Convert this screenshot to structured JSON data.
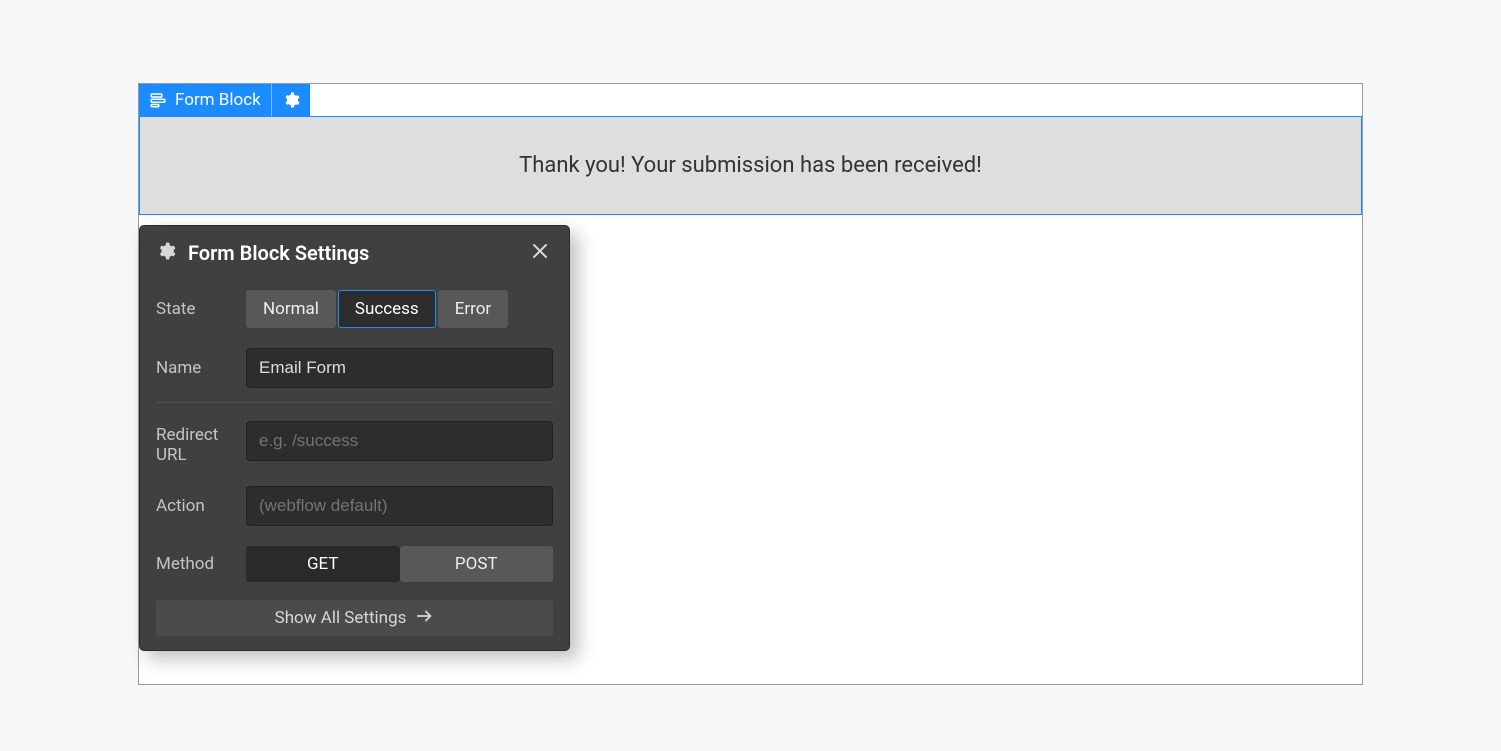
{
  "element_badge": {
    "label": "Form Block",
    "icon": "form-block-icon",
    "settings_icon": "gear-icon"
  },
  "success_message": "Thank you! Your submission has been received!",
  "settings": {
    "title": "Form Block Settings",
    "close_icon": "close-icon",
    "rows": {
      "state": {
        "label": "State",
        "options": [
          "Normal",
          "Success",
          "Error"
        ],
        "selected": "Success"
      },
      "name": {
        "label": "Name",
        "value": "Email Form"
      },
      "redirect": {
        "label": "Redirect URL",
        "value": "",
        "placeholder": "e.g. /success"
      },
      "action": {
        "label": "Action",
        "value": "",
        "placeholder": "(webflow default)"
      },
      "method": {
        "label": "Method",
        "options": [
          "GET",
          "POST"
        ],
        "selected": "GET"
      }
    },
    "show_all_label": "Show All Settings"
  }
}
